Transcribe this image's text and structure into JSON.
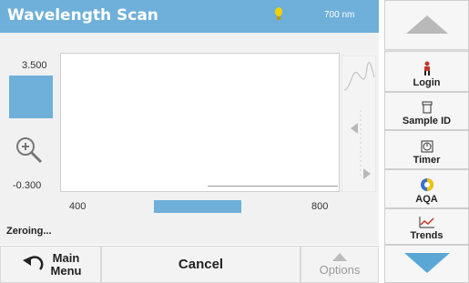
{
  "header": {
    "title": "Wavelength Scan",
    "wavelength": "700 nm",
    "lamp_icon": "lamp-icon"
  },
  "plot": {
    "y_max": "3.500",
    "y_min": "-0.300",
    "y_axis_button": "",
    "x_min": "400",
    "x_max": "800",
    "x_axis_button": ""
  },
  "status": "Zeroing...",
  "bottom": {
    "main_menu_line1": "Main",
    "main_menu_line2": "Menu",
    "cancel": "Cancel",
    "options": "Options"
  },
  "sidebar": {
    "login": "Login",
    "sample_id": "Sample ID",
    "timer": "Timer",
    "aqa": "AQA",
    "trends": "Trends"
  },
  "colors": {
    "accent": "#6fb0da",
    "down_arrow": "#5aa7d6"
  }
}
